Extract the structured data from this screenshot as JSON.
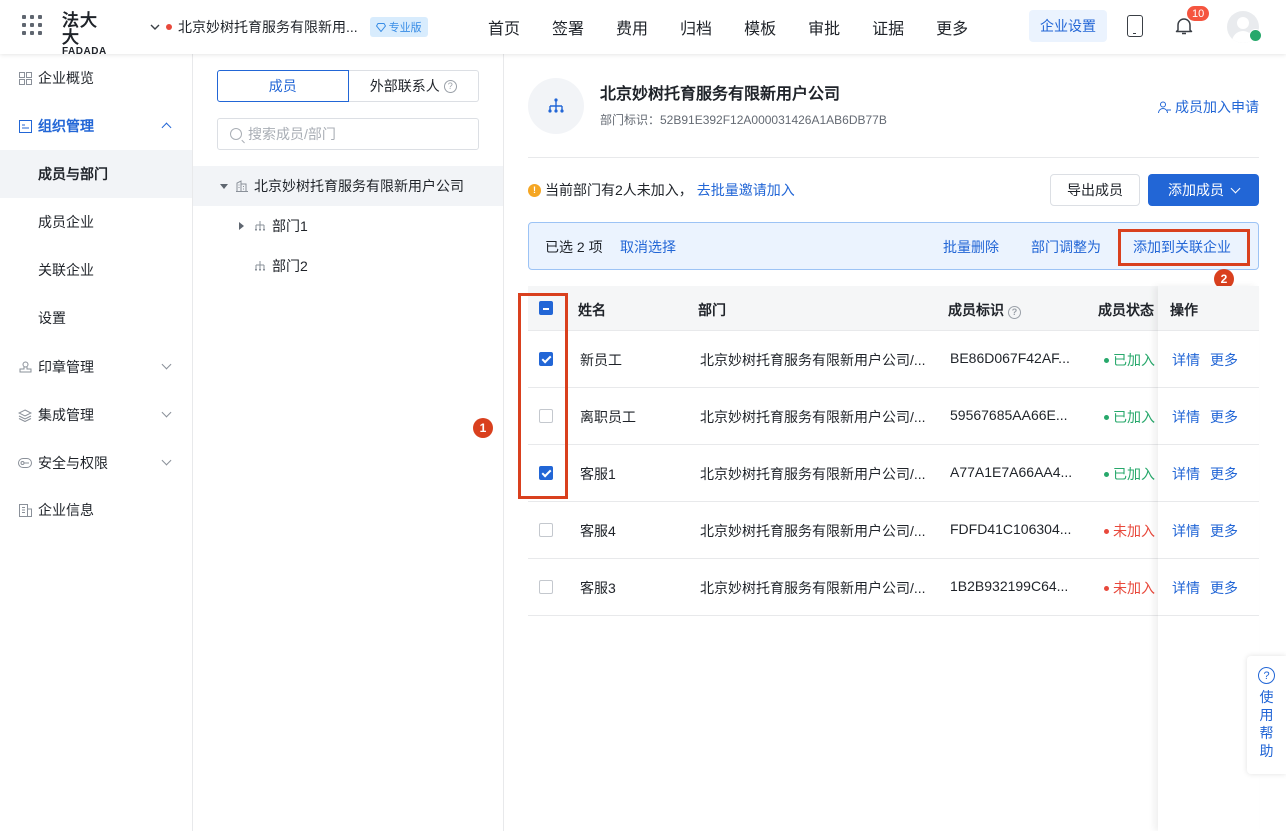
{
  "header": {
    "logo_top": "法大大",
    "logo_bottom": "FADADA",
    "company": "北京妙树托育服务有限新用...",
    "edition_badge": "专业版",
    "nav": [
      "首页",
      "签署",
      "费用",
      "归档",
      "模板",
      "审批",
      "证据",
      "更多"
    ],
    "settings_button": "企业设置",
    "notification_count": "10"
  },
  "sidebar": {
    "items": [
      {
        "label": "企业概览",
        "icon": "overview-icon"
      },
      {
        "label": "组织管理",
        "icon": "org-icon"
      },
      {
        "label": "成员与部门"
      },
      {
        "label": "成员企业"
      },
      {
        "label": "关联企业"
      },
      {
        "label": "设置"
      },
      {
        "label": "印章管理",
        "icon": "seal-icon"
      },
      {
        "label": "集成管理",
        "icon": "layers-icon"
      },
      {
        "label": "安全与权限",
        "icon": "key-icon"
      },
      {
        "label": "企业信息",
        "icon": "building-icon"
      }
    ]
  },
  "tree": {
    "tabs": [
      "成员",
      "外部联系人"
    ],
    "search_placeholder": "搜索成员/部门",
    "root": "北京妙树托育服务有限新用户公司",
    "children": [
      "部门1",
      "部门2"
    ]
  },
  "main": {
    "company_name": "北京妙树托育服务有限新用户公司",
    "dept_id_label": "部门标识：52B91E392F12A000031426A1AB6DB77B",
    "join_request_link": "成员加入申请",
    "notice_text": "当前部门有2人未加入，",
    "notice_link": "去批量邀请加入",
    "export_button": "导出成员",
    "add_button": "添加成员",
    "batch": {
      "selected_text": "已选 2 项",
      "cancel": "取消选择",
      "delete": "批量删除",
      "adjust": "部门调整为",
      "add_to_related": "添加到关联企业"
    },
    "callouts": [
      "1",
      "2"
    ],
    "table": {
      "headers": [
        "姓名",
        "部门",
        "成员标识",
        "成员状态",
        "操作"
      ],
      "rows": [
        {
          "name": "新员工",
          "dept": "北京妙树托育服务有限新用户公司/...",
          "id": "BE86D067F42AF...",
          "status": "已加入",
          "checked": true
        },
        {
          "name": "离职员工",
          "dept": "北京妙树托育服务有限新用户公司/...",
          "id": "59567685AA66E...",
          "status": "已加入",
          "checked": false
        },
        {
          "name": "客服1",
          "dept": "北京妙树托育服务有限新用户公司/...",
          "id": "A77A1E7A66AA4...",
          "status": "已加入",
          "checked": true
        },
        {
          "name": "客服4",
          "dept": "北京妙树托育服务有限新用户公司/...",
          "id": "FDFD41C106304...",
          "status": "未加入",
          "checked": false
        },
        {
          "name": "客服3",
          "dept": "北京妙树托育服务有限新用户公司/...",
          "id": "1B2B932199C64...",
          "status": "未加入",
          "checked": false
        }
      ],
      "action_detail": "详情",
      "action_more": "更多"
    }
  },
  "help_float": "使用帮助",
  "colors": {
    "primary": "#2266d6",
    "joined": "#27a86b",
    "not_joined": "#e8483b",
    "callout": "#d9401e"
  }
}
